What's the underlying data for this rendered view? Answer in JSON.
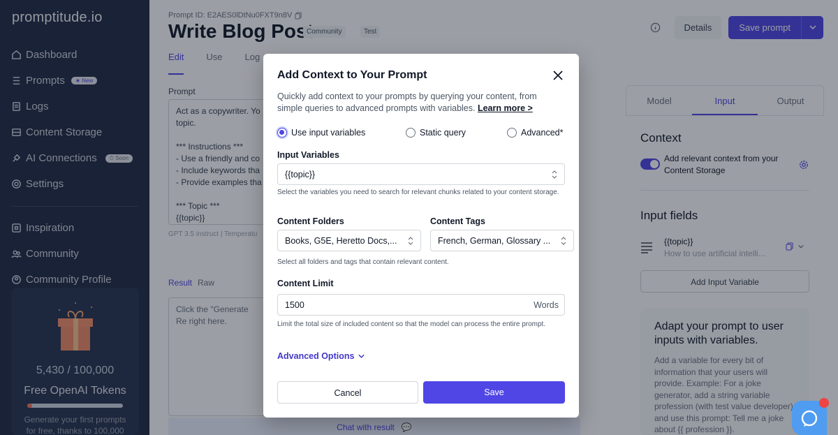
{
  "app": {
    "logo": "promptitude.io"
  },
  "sidebar": {
    "items": [
      {
        "label": "Dashboard",
        "icon": "home-icon"
      },
      {
        "label": "Prompts",
        "icon": "list-icon",
        "badge": "New"
      },
      {
        "label": "Logs",
        "icon": "doc-icon"
      },
      {
        "label": "Content Storage",
        "icon": "database-icon"
      },
      {
        "label": "AI Connections",
        "icon": "plug-icon",
        "badge": "Soon"
      },
      {
        "label": "Settings",
        "icon": "gear-icon"
      }
    ],
    "items2": [
      {
        "label": "Inspiration",
        "icon": "bulb-icon"
      },
      {
        "label": "Community",
        "icon": "users-icon"
      },
      {
        "label": "Community Profile",
        "icon": "user-icon"
      }
    ],
    "tokens": {
      "count": "5,430 / 100,000",
      "title": "Free OpenAI Tokens",
      "progress": 0.054,
      "desc": "Generate your first prompts for free, thanks to 100,000"
    }
  },
  "header": {
    "prompt_id": "Prompt ID: E2AES0lDtNu0FXT9n8V",
    "title": "Write Blog Post",
    "tags": [
      "Community",
      "Test"
    ],
    "tabs": [
      "Edit",
      "Use",
      "Log"
    ],
    "details_label": "Details",
    "save_label": "Save prompt"
  },
  "editor": {
    "prompt_label": "Prompt",
    "prompt_text": "Act as a copywriter. Yo\ntopic.\n\n*** Instructions ***\n- Use a friendly and co\n- Include keywords tha\n- Provide examples tha\n\n*** Topic ***\n{{topic}}",
    "model_line": "GPT 3.5 instruct | Temperatu",
    "result_tab": "Result",
    "raw_tab": "Raw",
    "result_placeholder": "Click the \"Generate Re right here.",
    "chat_with_result": "Chat with result"
  },
  "side_panel": {
    "tabs": [
      "Model",
      "Input",
      "Output"
    ],
    "context_title": "Context",
    "context_desc": "Add relevant context from your Content Storage",
    "input_fields_title": "Input fields",
    "variable_name": "{{topic}}",
    "variable_desc": "How to use artificial intelli...",
    "add_variable_label": "Add Input Variable",
    "adapt_title": "Adapt your prompt to user inputs with variables.",
    "adapt_desc": "Add a variable for every bit of information that your users will provide. Example: For a joke generator, add a string variable profession (with test value developer) and use this prompt: Tell me a joke about {{ profession }}."
  },
  "modal": {
    "title": "Add Context to Your Prompt",
    "desc": "Quickly add context to your prompts by querying your content, from simple queries to advanced prompts with variables.",
    "learn_more": "Learn more >",
    "radios": [
      "Use input variables",
      "Static query",
      "Advanced*"
    ],
    "input_variables_label": "Input Variables",
    "input_variables_value": "{{topic}}",
    "input_variables_help": "Select the variables you need to search for relevant chunks related to your content storage.",
    "content_folders_label": "Content Folders",
    "content_folders_value": "Books, G5E, Heretto Docs,...",
    "content_tags_label": "Content Tags",
    "content_tags_value": "French, German, Glossary ...",
    "folders_help": "Select all folders and tags that contain relevant content.",
    "content_limit_label": "Content Limit",
    "content_limit_value": "1500",
    "content_limit_unit": "Words",
    "content_limit_help": "Limit the total size of included content so that the model can process the entire prompt.",
    "advanced_options": "Advanced Options",
    "cancel_label": "Cancel",
    "save_label": "Save"
  },
  "colors": {
    "accent": "#4f46e5",
    "sidebar": "#1f2a44",
    "chat": "#4f9cf0"
  }
}
